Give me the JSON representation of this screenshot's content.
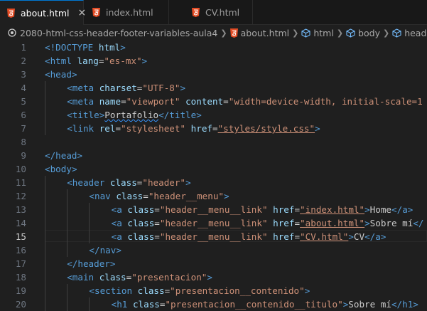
{
  "tabs": [
    {
      "label": "about.html",
      "active": true,
      "close": "×"
    },
    {
      "label": "index.html",
      "active": false
    },
    {
      "label": "CV.html",
      "active": false
    }
  ],
  "breadcrumb": {
    "folder": "2080-html-css-header-footer-variables-aula4",
    "file": "about.html",
    "items": [
      "html",
      "body",
      "header.h"
    ]
  },
  "editor": {
    "current_line": 15,
    "colors": {
      "tag": "#569cd6",
      "attr": "#9cdcfe",
      "string": "#ce9178",
      "text": "#cccccc"
    },
    "lines": [
      {
        "num": "1",
        "indent": 0,
        "tokens": [
          [
            "t",
            "<!"
          ],
          [
            "n",
            "DOCTYPE"
          ],
          [
            "x",
            " "
          ],
          [
            "a",
            "html"
          ],
          [
            "t",
            ">"
          ]
        ]
      },
      {
        "num": "2",
        "indent": 0,
        "tokens": [
          [
            "t",
            "<"
          ],
          [
            "n",
            "html"
          ],
          [
            "x",
            " "
          ],
          [
            "a",
            "lang"
          ],
          [
            "x",
            "="
          ],
          [
            "s",
            "\"es-mx\""
          ],
          [
            "t",
            ">"
          ]
        ]
      },
      {
        "num": "3",
        "indent": 0,
        "tokens": [
          [
            "t",
            "<"
          ],
          [
            "n",
            "head"
          ],
          [
            "t",
            ">"
          ]
        ]
      },
      {
        "num": "4",
        "indent": 1,
        "tokens": [
          [
            "t",
            "<"
          ],
          [
            "n",
            "meta"
          ],
          [
            "x",
            " "
          ],
          [
            "a",
            "charset"
          ],
          [
            "x",
            "="
          ],
          [
            "s",
            "\"UTF-8\""
          ],
          [
            "t",
            ">"
          ]
        ]
      },
      {
        "num": "5",
        "indent": 1,
        "tokens": [
          [
            "t",
            "<"
          ],
          [
            "n",
            "meta"
          ],
          [
            "x",
            " "
          ],
          [
            "a",
            "name"
          ],
          [
            "x",
            "="
          ],
          [
            "s",
            "\"viewport\""
          ],
          [
            "x",
            " "
          ],
          [
            "a",
            "content"
          ],
          [
            "x",
            "="
          ],
          [
            "s",
            "\"width=device-width, initial-scale=1"
          ]
        ]
      },
      {
        "num": "6",
        "indent": 1,
        "tokens": [
          [
            "t",
            "<"
          ],
          [
            "n",
            "title"
          ],
          [
            "t",
            ">"
          ],
          [
            "xw",
            "Portafolio"
          ],
          [
            "t",
            "</"
          ],
          [
            "n",
            "title"
          ],
          [
            "t",
            ">"
          ]
        ]
      },
      {
        "num": "7",
        "indent": 1,
        "tokens": [
          [
            "t",
            "<"
          ],
          [
            "n",
            "link"
          ],
          [
            "x",
            " "
          ],
          [
            "a",
            "rel"
          ],
          [
            "x",
            "="
          ],
          [
            "s",
            "\"stylesheet\""
          ],
          [
            "x",
            " "
          ],
          [
            "a",
            "href"
          ],
          [
            "x",
            "="
          ],
          [
            "su",
            "\"styles/style.css\""
          ],
          [
            "t",
            ">"
          ]
        ]
      },
      {
        "num": "8",
        "indent": 0,
        "tokens": []
      },
      {
        "num": "9",
        "indent": 0,
        "tokens": [
          [
            "t",
            "</"
          ],
          [
            "n",
            "head"
          ],
          [
            "t",
            ">"
          ]
        ]
      },
      {
        "num": "10",
        "indent": 0,
        "tokens": [
          [
            "t",
            "<"
          ],
          [
            "n",
            "body"
          ],
          [
            "t",
            ">"
          ]
        ]
      },
      {
        "num": "11",
        "indent": 1,
        "tokens": [
          [
            "t",
            "<"
          ],
          [
            "n",
            "header"
          ],
          [
            "x",
            " "
          ],
          [
            "a",
            "class"
          ],
          [
            "x",
            "="
          ],
          [
            "s",
            "\"header\""
          ],
          [
            "t",
            ">"
          ]
        ]
      },
      {
        "num": "12",
        "indent": 2,
        "tokens": [
          [
            "t",
            "<"
          ],
          [
            "n",
            "nav"
          ],
          [
            "x",
            " "
          ],
          [
            "a",
            "class"
          ],
          [
            "x",
            "="
          ],
          [
            "s",
            "\"header__menu\""
          ],
          [
            "t",
            ">"
          ]
        ]
      },
      {
        "num": "13",
        "indent": 3,
        "tokens": [
          [
            "t",
            "<"
          ],
          [
            "n",
            "a"
          ],
          [
            "x",
            " "
          ],
          [
            "a",
            "class"
          ],
          [
            "x",
            "="
          ],
          [
            "s",
            "\"header__menu__link\""
          ],
          [
            "x",
            " "
          ],
          [
            "a",
            "href"
          ],
          [
            "x",
            "="
          ],
          [
            "su",
            "\"index.html\""
          ],
          [
            "t",
            ">"
          ],
          [
            "x",
            "Home"
          ],
          [
            "t",
            "</"
          ],
          [
            "n",
            "a"
          ],
          [
            "t",
            ">"
          ]
        ]
      },
      {
        "num": "14",
        "indent": 3,
        "tokens": [
          [
            "t",
            "<"
          ],
          [
            "n",
            "a"
          ],
          [
            "x",
            " "
          ],
          [
            "a",
            "class"
          ],
          [
            "x",
            "="
          ],
          [
            "s",
            "\"header__menu__link\""
          ],
          [
            "x",
            " "
          ],
          [
            "a",
            "href"
          ],
          [
            "x",
            "="
          ],
          [
            "su",
            "\"about.html\""
          ],
          [
            "t",
            ">"
          ],
          [
            "x",
            "Sobre mí"
          ],
          [
            "t",
            "</"
          ]
        ]
      },
      {
        "num": "15",
        "indent": 3,
        "tokens": [
          [
            "t",
            "<"
          ],
          [
            "n",
            "a"
          ],
          [
            "x",
            " "
          ],
          [
            "a",
            "class"
          ],
          [
            "x",
            "="
          ],
          [
            "s",
            "\"header__menu__link\""
          ],
          [
            "x",
            " "
          ],
          [
            "a",
            "href"
          ],
          [
            "x",
            "="
          ],
          [
            "su",
            "\"CV.html\""
          ],
          [
            "t",
            ">"
          ],
          [
            "x",
            "CV"
          ],
          [
            "t",
            "</"
          ],
          [
            "n",
            "a"
          ],
          [
            "t",
            ">"
          ]
        ]
      },
      {
        "num": "16",
        "indent": 2,
        "tokens": [
          [
            "t",
            "</"
          ],
          [
            "n",
            "nav"
          ],
          [
            "t",
            ">"
          ]
        ]
      },
      {
        "num": "17",
        "indent": 1,
        "tokens": [
          [
            "t",
            "</"
          ],
          [
            "n",
            "header"
          ],
          [
            "t",
            ">"
          ]
        ]
      },
      {
        "num": "18",
        "indent": 1,
        "tokens": [
          [
            "t",
            "<"
          ],
          [
            "n",
            "main"
          ],
          [
            "x",
            " "
          ],
          [
            "a",
            "class"
          ],
          [
            "x",
            "="
          ],
          [
            "s",
            "\"presentacion\""
          ],
          [
            "t",
            ">"
          ]
        ]
      },
      {
        "num": "19",
        "indent": 2,
        "tokens": [
          [
            "t",
            "<"
          ],
          [
            "n",
            "section"
          ],
          [
            "x",
            " "
          ],
          [
            "a",
            "class"
          ],
          [
            "x",
            "="
          ],
          [
            "s",
            "\"presentacion__contenido\""
          ],
          [
            "t",
            ">"
          ]
        ]
      },
      {
        "num": "20",
        "indent": 3,
        "tokens": [
          [
            "t",
            "<"
          ],
          [
            "n",
            "h1"
          ],
          [
            "x",
            " "
          ],
          [
            "a",
            "class"
          ],
          [
            "x",
            "="
          ],
          [
            "s",
            "\"presentacion__contenido__titulo\""
          ],
          [
            "t",
            ">"
          ],
          [
            "x",
            "Sobre mí"
          ],
          [
            "t",
            "</"
          ],
          [
            "n",
            "h1"
          ],
          [
            "t",
            ">"
          ]
        ]
      }
    ]
  },
  "icons": {
    "html_file": "html5-icon",
    "element": "cube-icon",
    "folder": "git-compare-icon"
  }
}
